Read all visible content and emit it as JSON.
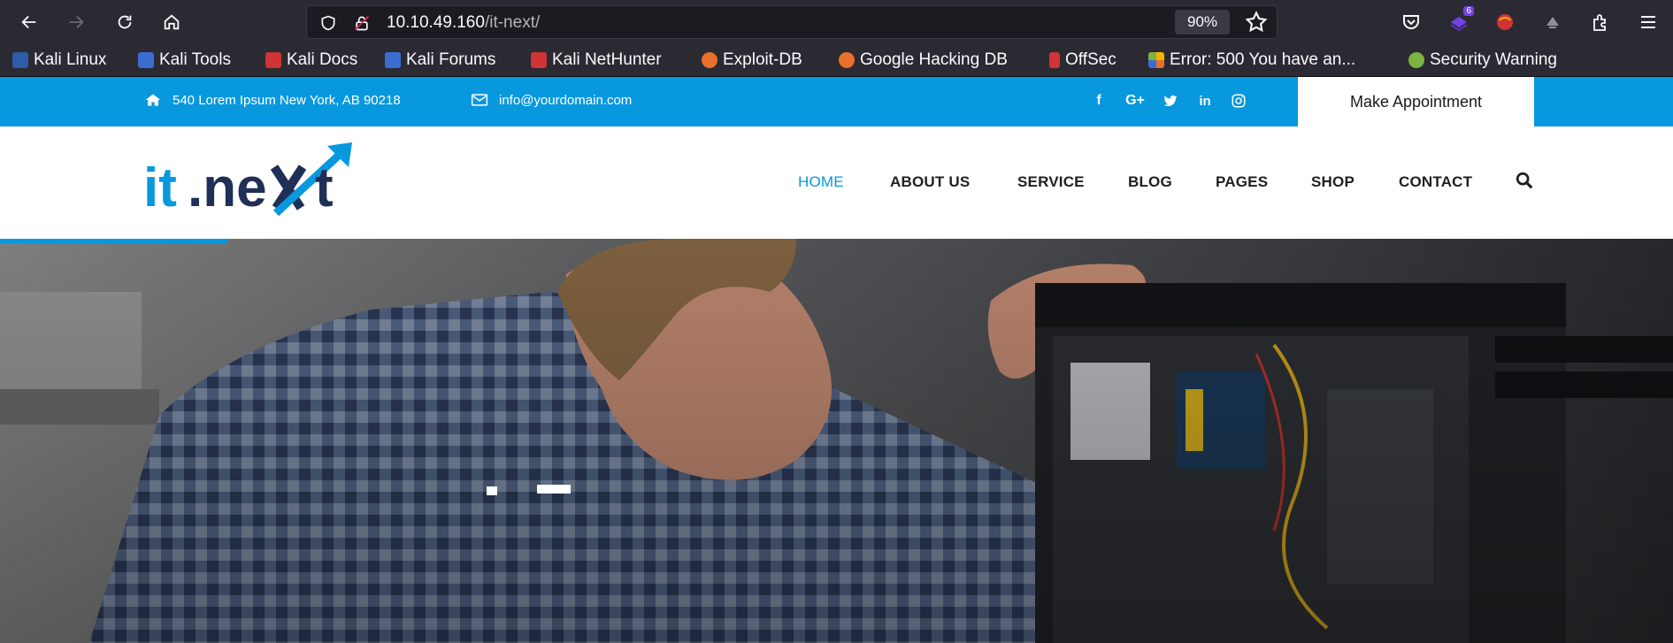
{
  "browser": {
    "url_host": "10.10.49.160",
    "url_path": "/it-next/",
    "zoom": "90%",
    "extension_badge": "6"
  },
  "bookmarks": [
    {
      "label": "Kali Linux",
      "color": "#2d5ca8"
    },
    {
      "label": "Kali Tools",
      "color": "#3b6dd1"
    },
    {
      "label": "Kali Docs",
      "color": "#d03434"
    },
    {
      "label": "Kali Forums",
      "color": "#3b6dd1"
    },
    {
      "label": "Kali NetHunter",
      "color": "#d03434"
    },
    {
      "label": "Exploit-DB",
      "color": "#e8702a"
    },
    {
      "label": "Google Hacking DB",
      "color": "#e8702a"
    },
    {
      "label": "OffSec",
      "color": "#d03434"
    },
    {
      "label": "Error: 500 You have an...",
      "color": "#f4b400"
    },
    {
      "label": "Security Warning",
      "color": "#7cb342"
    }
  ],
  "site": {
    "address": "540 Lorem Ipsum New York, AB 90218",
    "email": "info@yourdomain.com",
    "social": [
      "facebook-icon",
      "google-plus-icon",
      "twitter-icon",
      "linkedin-icon",
      "instagram-icon"
    ],
    "appointment_label": "Make Appointment",
    "logo_text": "it.next",
    "menu": [
      "HOME",
      "ABOUT US",
      "SERVICE",
      "BLOG",
      "PAGES",
      "SHOP",
      "CONTACT"
    ],
    "accent_color": "#0898de",
    "dark_color": "#1f2f56"
  }
}
